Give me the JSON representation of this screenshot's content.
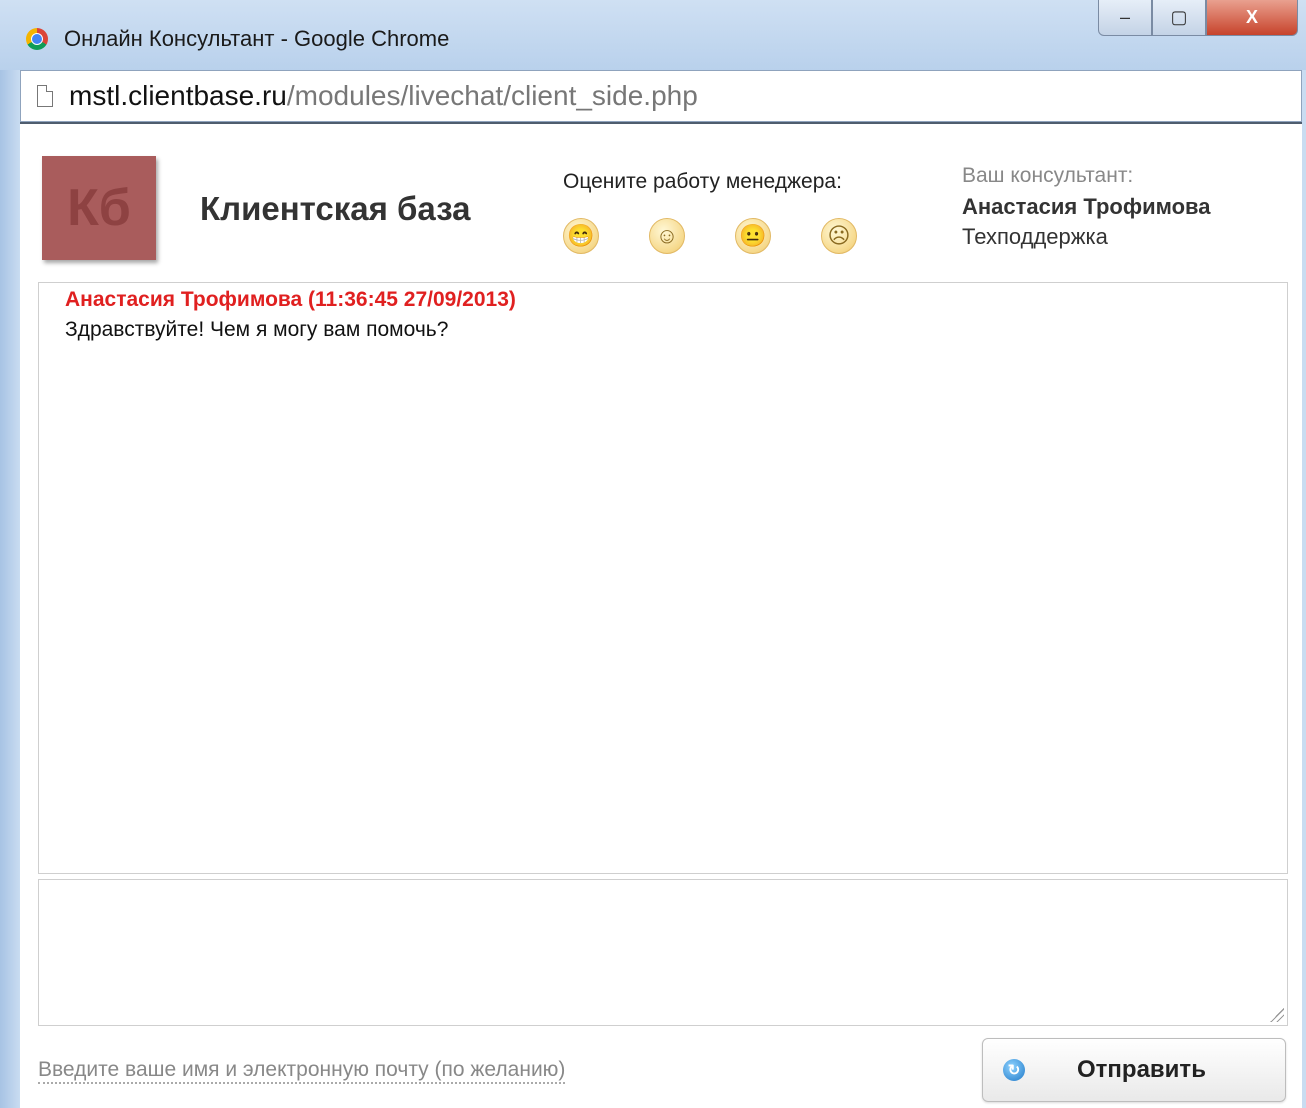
{
  "window": {
    "title": "Онлайн Консультант - Google Chrome",
    "controls": {
      "minimize_glyph": "–",
      "maximize_glyph": "▢",
      "close_glyph": "X"
    }
  },
  "address_bar": {
    "host": "mstl.clientbase.ru",
    "path": "/modules/livechat/client_side.php"
  },
  "header": {
    "logo_text": "Кб",
    "brand_name": "Клиентская база",
    "rating": {
      "label": "Оцените работу менеджера:",
      "faces": [
        {
          "icon": "laughing-face-icon",
          "glyph": "😁"
        },
        {
          "icon": "smiling-face-icon",
          "glyph": "☺"
        },
        {
          "icon": "neutral-face-icon",
          "glyph": "😐"
        },
        {
          "icon": "sad-face-icon",
          "glyph": "☹"
        }
      ]
    },
    "consultant": {
      "caption": "Ваш консультант:",
      "name": "Анастасия Трофимова",
      "department": "Техподдержка"
    }
  },
  "chat": {
    "messages": [
      {
        "header": "Анастасия Трофимова (11:36:45 27/09/2013)",
        "text": "Здравствуйте! Чем я могу вам помочь?"
      }
    ]
  },
  "composer": {
    "value": "",
    "name_email_link": "Введите ваше имя и электронную почту (по желанию)",
    "send_label": "Отправить",
    "send_icon_glyph": "↻"
  },
  "colors": {
    "message_author": "#e02020",
    "logo_background": "#a95c5c"
  }
}
